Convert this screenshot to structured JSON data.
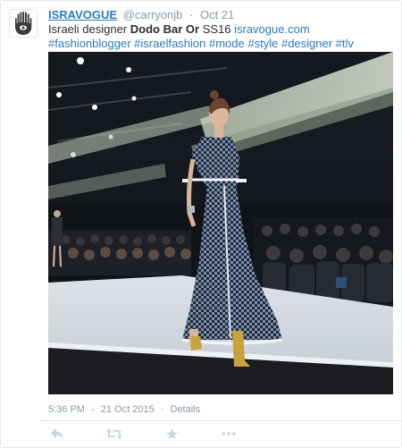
{
  "account": {
    "display_name": "ISRAVOGUE",
    "handle": "@carryonjb",
    "timestamp": "Oct 21",
    "avatar_icon": "hamsa-logo-icon"
  },
  "tweet": {
    "text_lead": "Israeli designer ",
    "bold_name": "Dodo Bar Or",
    "text_after_bold": " SS16 ",
    "link": "isravogue.com",
    "hashtags": [
      "#fashionblogger",
      "#israelfashion",
      "#mode",
      "#style",
      "#designer",
      "#tlv"
    ]
  },
  "photo": {
    "description_icon": "runway-photo"
  },
  "meta": {
    "time": "5:36 PM",
    "separator": "-",
    "date": "21 Oct 2015",
    "dot": "·",
    "details_label": "Details"
  },
  "actions": [
    {
      "name": "reply-icon"
    },
    {
      "name": "retweet-icon"
    },
    {
      "name": "favorite-icon"
    },
    {
      "name": "more-icon"
    }
  ],
  "colors": {
    "link": "#2b7bb9",
    "muted": "#8899a6",
    "text": "#292f33",
    "action_icon": "#ccd6dd"
  }
}
